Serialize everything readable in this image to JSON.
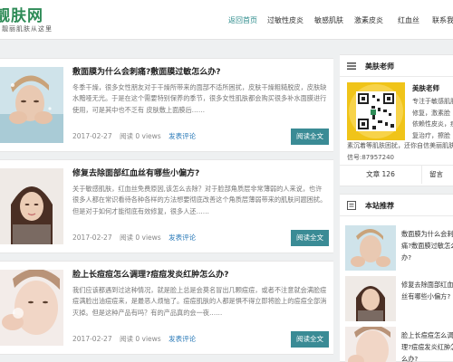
{
  "site": {
    "logo_text": "靓肤网",
    "logo_sub": "靓丽肌肤从这里"
  },
  "nav": {
    "items": [
      "返回首页",
      "过敏性皮炎",
      "敏感肌肤",
      "激素皮炎",
      "红血丝",
      "联系我"
    ],
    "active_index": 0
  },
  "posts": [
    {
      "title": "敷面膜为什么会刺痛?敷面膜过敏怎么办?",
      "excerpt": "冬季干燥，很多女性朋友对于干燥所带来的面部不适所困扰，皮肤干燥粗糙脱皮，皮肤缺水黯哑无光。于是在这个需要特别保养的季节，很多女性肌肤都会购买很多补水面膜进行使用，可是其中也不乏有 皮肤敷上面膜后……",
      "date": "2017-02-27",
      "views": "阅读 0 views",
      "comment": "发表评论",
      "more": "阅读全文"
    },
    {
      "title": "修复去除面部红血丝有哪些小偏方?",
      "excerpt": "关于敏感肌肤，红血丝免费原因,该怎么去除？对于脸部角质层非常薄弱的人来说，也许很多人都在常识看待各种各样的方法想要彻底改善这个角质层薄弱带来的肌肤问题困扰。但是对于如何才能彻底有效修复，很多人还……",
      "date": "2017-02-27",
      "views": "阅读 0 views",
      "comment": "发表评论",
      "more": "阅读全文"
    },
    {
      "title": "脸上长痘痘怎么调理?痘痘发炎红肿怎么办?",
      "excerpt": "我们应该都遇到过这种情况，就是脸上总是会莫名冒出几颗痘痘，或者不注意就会满脸痘痘满脸出油痘痘来，是最恶人烦恼了。痘痘肌肤的人都是惧不得立即将脸上的痘痘全部消灭掉。但是这种产品有吗？有的产品真的会一夜……",
      "date": "2017-02-27",
      "views": "阅读 0 views",
      "comment": "发表评论",
      "more": "阅读全文"
    }
  ],
  "author_widget": {
    "title": "美肤老师",
    "name": "美肤老师",
    "bio_lines": [
      "专注于敏感肌肤",
      "修复，激素脸",
      "依赖性皮炎，痘",
      "复治疗，擦脸",
      "/痛/干燥/脱皮"
    ],
    "bio_tail": [
      "素沉着等肌肤困扰，还你自信美丽肌肤",
      "信号:87957240"
    ],
    "stat_articles": "文章 126",
    "stat_comments": "留言"
  },
  "recommend_widget": {
    "title": "本站推荐",
    "items": [
      "敷面膜为什么会刺痛?敷面膜过敏怎么办?",
      "修复去除面部红血丝有哪些小偏方?",
      "脸上长痘痘怎么调理?痘痘发炎红肿怎么办?"
    ]
  },
  "colors": {
    "accent": "#3a8b95",
    "nav_active": "#2a8a8a",
    "logo": "#2e8b57",
    "link": "#2a7ab8"
  },
  "icons": [
    "menu-icon",
    "reading-icon",
    "qr-code-icon"
  ]
}
